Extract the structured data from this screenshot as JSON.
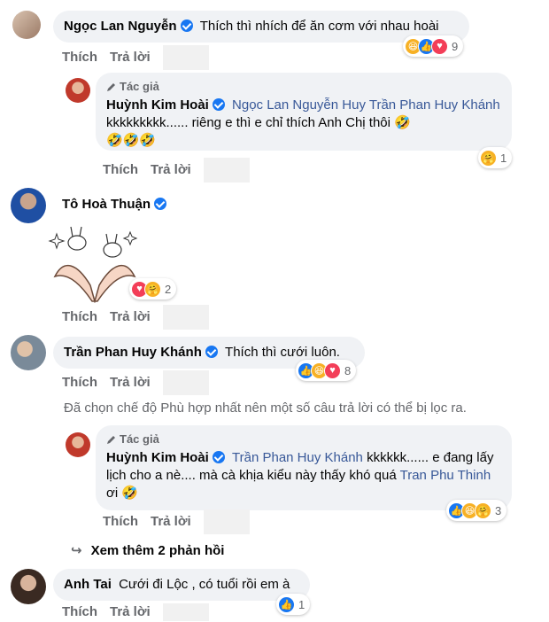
{
  "actions": {
    "like": "Thích",
    "reply": "Trả lời"
  },
  "author_badge": "Tác giả",
  "comments": [
    {
      "name": "Ngọc Lan Nguyễn",
      "text": "Thích thì nhích để ăn cơm với nhau hoài",
      "reaction_count": "9"
    },
    {
      "name": "Huỳnh Kim Hoài",
      "mentions": [
        "Ngọc Lan Nguyễn",
        "Huy Trần Phan Huy Khánh"
      ],
      "text_line1_after": "kkkkkkkkk...... riêng e thì e chỉ thích Anh Chị thôi",
      "reaction_count": "1"
    },
    {
      "name": "Tô Hoà Thuận",
      "reaction_count": "2"
    },
    {
      "name": "Trần Phan Huy Khánh",
      "text": "Thích thì cưới luôn.",
      "reaction_count": "8"
    },
    {
      "name": "Huỳnh Kim Hoài",
      "mention1": "Trần Phan Huy Khánh",
      "text_a": "kkkkkk...... e đang lấy lịch cho a nè.... mà cà khịa kiểu này thấy khó quá",
      "mention2": "Tran Phu Thinh",
      "text_b": "ơi",
      "reaction_count": "3"
    },
    {
      "name": "Anh Tai",
      "text": "Cưới đi Lộc , có tuổi rồi em à",
      "reaction_count": "1"
    }
  ],
  "filter_note": "Đã chọn chế độ Phù hợp nhất nên một số câu trả lời có thể bị lọc ra.",
  "more_replies": "Xem thêm 2 phản hồi",
  "colors": {
    "link": "#385898",
    "verified": "#1877f2",
    "bubble": "#f0f2f5",
    "secondary": "#65676b"
  }
}
